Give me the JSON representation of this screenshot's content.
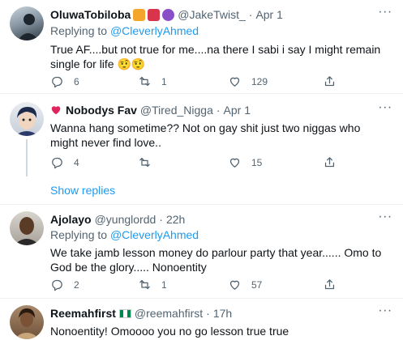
{
  "tweets": [
    {
      "name": "OluwaTobiloba",
      "emojis": [
        "tiger-face-emoji",
        "gift-emoji",
        "smiling-devil-emoji"
      ],
      "handle": "@JakeTwist_",
      "dot": "·",
      "date": "Apr 1",
      "replying_prefix": "Replying to",
      "replying_to": "@CleverlyAhmed",
      "text": "True AF....but not true for me....na there I sabi i say I might remain single for life 🤨🤨",
      "reply_count": "6",
      "retweet_count": "1",
      "like_count": "129"
    },
    {
      "name": "Nobodys Fav",
      "handle": "@Tired_Nigga",
      "dot": "·",
      "date": "Apr 1",
      "text": "Wanna hang sometime?? Not on gay shit just two niggas who might never find love..",
      "reply_count": "4",
      "retweet_count": "",
      "like_count": "15"
    },
    {
      "name": "Ajolayo",
      "handle": "@yunglordd",
      "dot": "·",
      "date": "22h",
      "replying_prefix": "Replying to",
      "replying_to": "@CleverlyAhmed",
      "text": "We take jamb lesson money do parlour party that year...... Omo to God be the glory..... Nonoentity",
      "reply_count": "2",
      "retweet_count": "1",
      "like_count": "57"
    },
    {
      "name": "Reemahfirst",
      "handle": "@reemahfirst",
      "dot": "·",
      "date": "17h",
      "text": "Nonoentity! Omoooo you no go lesson true true"
    }
  ],
  "show_replies": "Show replies",
  "more_glyph": "···",
  "colors": {
    "accent": "#1d9bf0",
    "secondary_text": "#536471",
    "heart_red": "#e0245e",
    "divider": "#eff3f4"
  }
}
